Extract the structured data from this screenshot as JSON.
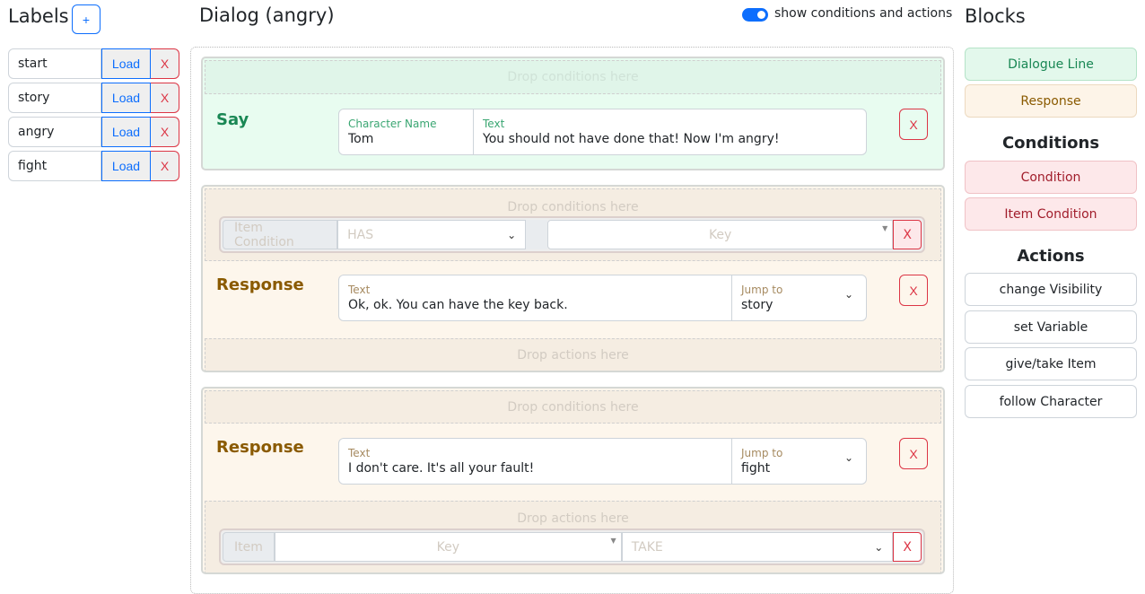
{
  "labels": {
    "title": "Labels",
    "add_label": "+",
    "load_label": "Load",
    "delete_label": "X",
    "items": [
      "start",
      "story",
      "angry",
      "fight"
    ]
  },
  "dialog": {
    "title": "Dialog (angry)",
    "toggle_label": "show conditions and actions",
    "toggle_on": true,
    "drop_conditions": "Drop conditions here",
    "drop_actions": "Drop actions here",
    "delete_label": "X",
    "say": {
      "title": "Say",
      "character_label": "Character Name",
      "character": "Tom",
      "text_label": "Text",
      "text": "You should not have done that! Now I'm angry!"
    },
    "response1": {
      "title": "Response",
      "text_label": "Text",
      "text": "Ok, ok. You can have the key back.",
      "jump_label": "Jump to",
      "jump": "story",
      "condition": {
        "label": "Item Condition",
        "operator": "HAS",
        "item": "Key"
      }
    },
    "response2": {
      "title": "Response",
      "text_label": "Text",
      "text": "I don't care. It's all your fault!",
      "jump_label": "Jump to",
      "jump": "fight",
      "action": {
        "label": "Item",
        "item": "Key",
        "operation": "TAKE"
      }
    }
  },
  "blocks": {
    "title": "Blocks",
    "dialogue_line": "Dialogue Line",
    "response": "Response",
    "conditions_title": "Conditions",
    "condition": "Condition",
    "item_condition": "Item Condition",
    "actions_title": "Actions",
    "actions": [
      "change Visibility",
      "set Variable",
      "give/take Item",
      "follow Character"
    ]
  },
  "colors": {
    "primary": "#0d6efd",
    "danger": "#dc3545",
    "say_green": "#198754",
    "response_brown": "#8a5a00"
  }
}
